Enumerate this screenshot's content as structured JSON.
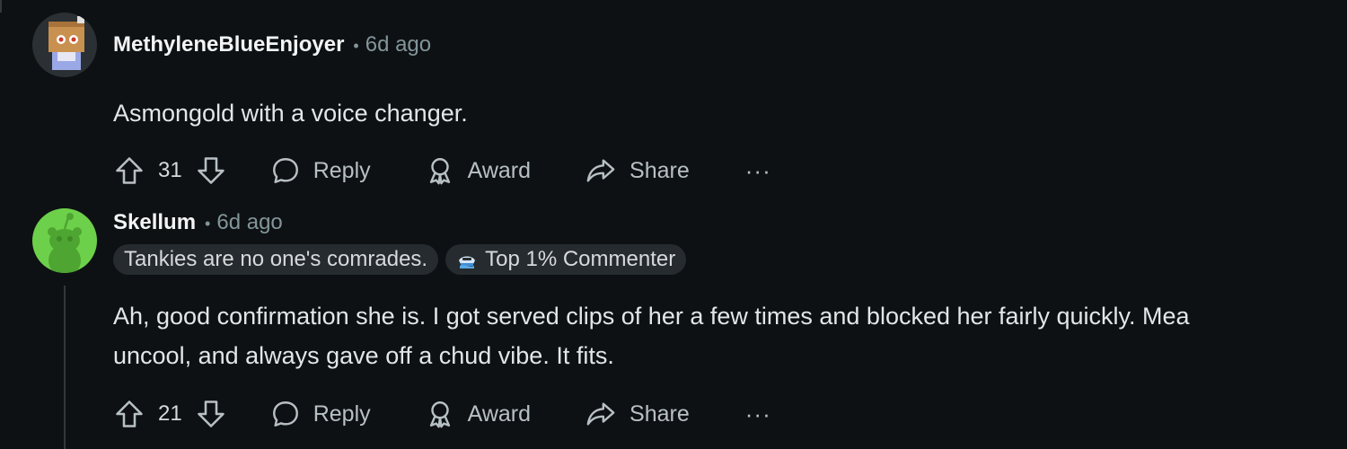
{
  "comments": [
    {
      "author": "MethyleneBlueEnjoyer",
      "separator": "•",
      "time": "6d ago",
      "avatar": "cardboard-box-avatar-icon",
      "body": [
        "Asmongold with a voice changer."
      ],
      "votes": "31",
      "actions": {
        "reply": "Reply",
        "award": "Award",
        "share": "Share",
        "more": "···"
      }
    },
    {
      "author": "Skellum",
      "separator": "•",
      "time": "6d ago",
      "avatar": "green-snoo-avatar-icon",
      "flairs": [
        "Tankies are no one's comrades.",
        "Top 1% Commenter"
      ],
      "body": [
        "Ah, good confirmation she is. I got served clips of her a few times and blocked her fairly quickly. Mea",
        "uncool, and always gave off a chud vibe. It fits."
      ],
      "votes": "21",
      "actions": {
        "reply": "Reply",
        "award": "Award",
        "share": "Share",
        "more": "···"
      }
    }
  ],
  "colors": {
    "background": "#0e1113",
    "avatar_green": "#6dd04a",
    "flair_bg": "#252b2e"
  }
}
